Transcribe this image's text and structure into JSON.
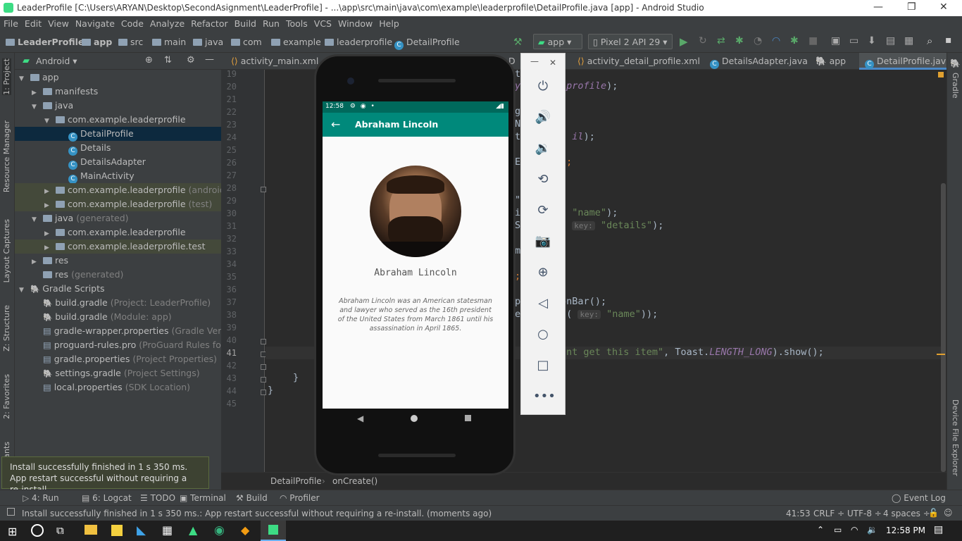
{
  "window": {
    "title": "LeaderProfile [C:\\Users\\ARYAN\\Desktop\\SecondAsignment\\LeaderProfile] - ...\\app\\src\\main\\java\\com\\example\\leaderprofile\\DetailProfile.java [app] - Android Studio",
    "minimize": "—",
    "restore": "❐",
    "close": "✕"
  },
  "menu": [
    "File",
    "Edit",
    "View",
    "Navigate",
    "Code",
    "Analyze",
    "Refactor",
    "Build",
    "Run",
    "Tools",
    "VCS",
    "Window",
    "Help"
  ],
  "breadcrumb": {
    "items": [
      "LeaderProfile",
      "app",
      "src",
      "main",
      "java",
      "com",
      "example",
      "leaderprofile",
      "DetailProfile"
    ],
    "run_config": "app",
    "device": "Pixel 2 API 29"
  },
  "left_strip": [
    "1: Project",
    "Resource Manager",
    "Layout Captures",
    "Z: Structure",
    "2: Favorites",
    "ants"
  ],
  "right_strip": [
    "Gradle",
    "Device File Explorer"
  ],
  "project_panel": {
    "view": "Android",
    "tree": [
      {
        "label": "app",
        "extra": "",
        "indent": 0,
        "arrow": "▼",
        "icon": "folder"
      },
      {
        "label": "manifests",
        "extra": "",
        "indent": 1,
        "arrow": "▶",
        "icon": "folder"
      },
      {
        "label": "java",
        "extra": "",
        "indent": 1,
        "arrow": "▼",
        "icon": "folder"
      },
      {
        "label": "com.example.leaderprofile",
        "extra": "",
        "indent": 2,
        "arrow": "▼",
        "icon": "folder"
      },
      {
        "label": "DetailProfile",
        "extra": "",
        "indent": 3,
        "arrow": "",
        "icon": "class",
        "selected": true
      },
      {
        "label": "Details",
        "extra": "",
        "indent": 3,
        "arrow": "",
        "icon": "class"
      },
      {
        "label": "DetailsAdapter",
        "extra": "",
        "indent": 3,
        "arrow": "",
        "icon": "class"
      },
      {
        "label": "MainActivity",
        "extra": "",
        "indent": 3,
        "arrow": "",
        "icon": "class"
      },
      {
        "label": "com.example.leaderprofile",
        "extra": "(androidTest)",
        "indent": 2,
        "arrow": "▶",
        "icon": "folder",
        "highlight": true
      },
      {
        "label": "com.example.leaderprofile",
        "extra": "(test)",
        "indent": 2,
        "arrow": "▶",
        "icon": "folder",
        "highlight": true
      },
      {
        "label": "java",
        "extra": "(generated)",
        "indent": 1,
        "arrow": "▼",
        "icon": "folder"
      },
      {
        "label": "com.example.leaderprofile",
        "extra": "",
        "indent": 2,
        "arrow": "▶",
        "icon": "folder"
      },
      {
        "label": "com.example.leaderprofile.test",
        "extra": "",
        "indent": 2,
        "arrow": "▶",
        "icon": "folder",
        "highlight": true
      },
      {
        "label": "res",
        "extra": "",
        "indent": 1,
        "arrow": "▶",
        "icon": "folder"
      },
      {
        "label": "res",
        "extra": "(generated)",
        "indent": 1,
        "arrow": "",
        "icon": "folder"
      },
      {
        "label": "Gradle Scripts",
        "extra": "",
        "indent": 0,
        "arrow": "▼",
        "icon": "gradle"
      },
      {
        "label": "build.gradle",
        "extra": "(Project: LeaderProfile)",
        "indent": 1,
        "arrow": "",
        "icon": "gradle"
      },
      {
        "label": "build.gradle",
        "extra": "(Module: app)",
        "indent": 1,
        "arrow": "",
        "icon": "gradle"
      },
      {
        "label": "gradle-wrapper.properties",
        "extra": "(Gradle Version)",
        "indent": 1,
        "arrow": "",
        "icon": "props"
      },
      {
        "label": "proguard-rules.pro",
        "extra": "(ProGuard Rules for app)",
        "indent": 1,
        "arrow": "",
        "icon": "props"
      },
      {
        "label": "gradle.properties",
        "extra": "(Project Properties)",
        "indent": 1,
        "arrow": "",
        "icon": "props"
      },
      {
        "label": "settings.gradle",
        "extra": "(Project Settings)",
        "indent": 1,
        "arrow": "",
        "icon": "gradle"
      },
      {
        "label": "local.properties",
        "extra": "(SDK Location)",
        "indent": 1,
        "arrow": "",
        "icon": "props"
      }
    ]
  },
  "editor": {
    "tabs": [
      {
        "label": "activity_main.xml",
        "active": false
      },
      {
        "label": "D",
        "active": false
      },
      {
        "label": "activity_detail_profile.xml",
        "active": false
      },
      {
        "label": "DetailsAdapter.java",
        "active": false
      },
      {
        "label": "app",
        "active": false
      },
      {
        "label": "DetailProfile.java",
        "active": true
      }
    ],
    "line_numbers": [
      "19",
      "20",
      "21",
      "22",
      "23",
      "24",
      "25",
      "26",
      "27",
      "28",
      "29",
      "30",
      "31",
      "32",
      "33",
      "34",
      "35",
      "36",
      "37",
      "38",
      "39",
      "40",
      "41",
      "42",
      "43",
      "44",
      "45"
    ],
    "code_frags": {
      "l19": "t",
      "l20a": "y",
      "l20b": "_profile",
      "l20c": ");",
      "l22": "g",
      "l23": "N",
      "l24a": "t",
      "l24b": "il",
      "l24c": ");",
      "l26a": "E",
      "l26b": ";",
      "l29": "\"",
      "l30a": "i",
      "l30b": "\"name\"",
      "l30c": ");",
      "l31a": "S",
      "l31hint": "key:",
      "l31b": "\"details\"",
      "l31c": ");",
      "l33": "m",
      "l35": ";",
      "l37a": "p",
      "l37b": "ionBar();",
      "l38a": "e",
      "l38b": "(",
      "l38hint": "key:",
      "l38c": "\"name\"",
      "l38d": "));",
      "l41a": "nt get this item\"",
      "l41b": ", Toast.",
      "l41c": "LENGTH_LONG",
      "l41d": ").show();",
      "l43": "}",
      "l44": "}"
    },
    "crumb": [
      "DetailProfile",
      "onCreate()"
    ]
  },
  "emulator": {
    "status_time": "12:58",
    "app_title": "Abraham Lincoln",
    "name": "Abraham Lincoln",
    "description": "Abraham Lincoln was an American statesman and lawyer who served as the 16th president of the United States from March 1861 until his assassination in April 1865.",
    "window_min": "—",
    "window_close": "✕"
  },
  "notification": {
    "line1": "Install successfully finished in 1 s 350 ms.",
    "line2": "App restart successful without requiring a re-install."
  },
  "bottom_tabs": [
    "4: Run",
    "6: Logcat",
    "TODO",
    "Terminal",
    "Build",
    "Profiler",
    "Event Log"
  ],
  "status": {
    "message": "Install successfully finished in 1 s 350 ms.: App restart successful without requiring a re-install. (moments ago)",
    "position": "41:53",
    "line_sep": "CRLF ÷",
    "encoding": "UTF-8 ÷",
    "indent": "4 spaces ÷"
  },
  "taskbar": {
    "time": "12:58 PM"
  }
}
